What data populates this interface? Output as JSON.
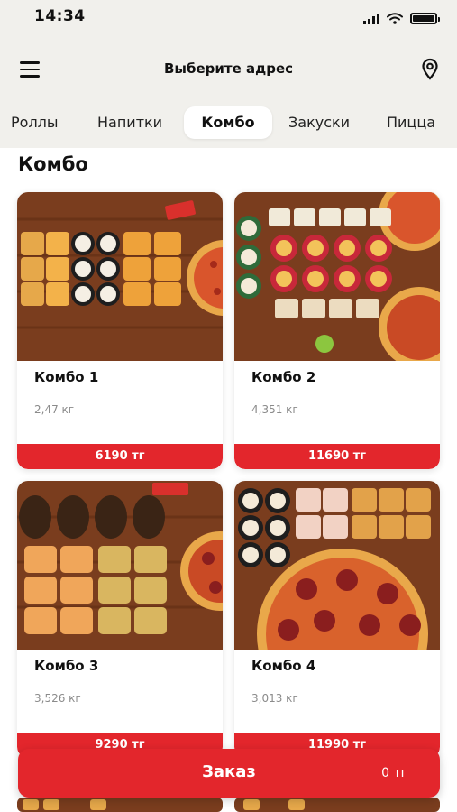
{
  "status_bar": {
    "time": "14:34"
  },
  "header": {
    "title": "Выберите адрес"
  },
  "tabs": [
    {
      "label": "Роллы",
      "active": false
    },
    {
      "label": "Напитки",
      "active": false
    },
    {
      "label": "Комбо",
      "active": true
    },
    {
      "label": "Закуски",
      "active": false
    },
    {
      "label": "Пицца",
      "active": false
    }
  ],
  "section": {
    "title": "Комбо"
  },
  "products": [
    {
      "name": "Комбо 1",
      "weight": "2,47 кг",
      "price": "6190 тг"
    },
    {
      "name": "Комбо 2",
      "weight": "4,351 кг",
      "price": "11690 тг"
    },
    {
      "name": "Комбо 3",
      "weight": "3,526 кг",
      "price": "9290 тг"
    },
    {
      "name": "Комбо 4",
      "weight": "3,013 кг",
      "price": "11990 тг"
    }
  ],
  "order": {
    "label": "Заказ",
    "total": "0 тг"
  },
  "colors": {
    "accent": "#e3262c",
    "header_bg": "#f1f0ec",
    "wood": "#7a3d1e"
  },
  "icons": [
    "menu-icon",
    "location-pin-icon",
    "signal-icon",
    "wifi-icon",
    "battery-icon"
  ]
}
